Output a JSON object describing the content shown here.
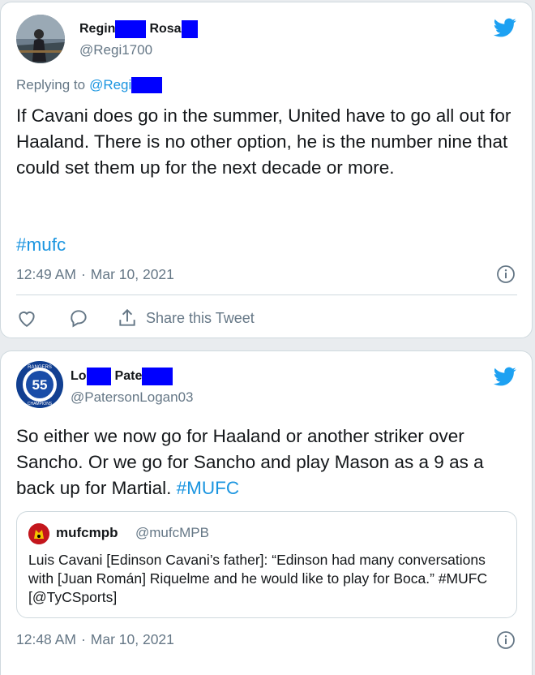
{
  "tweet1": {
    "display_name_part1": "Regin",
    "display_name_part2": "Rosa",
    "handle": "@Regi1700",
    "replying_label": "Replying to",
    "replying_handle": "@Regi",
    "text": "If Cavani does go in the summer, United have to go all out for Haaland. There is no other option, he is the number nine that could set them up for the next decade or more.",
    "hashtag": "#mufc",
    "time": "12:49 AM",
    "separator": "·",
    "date": "Mar 10, 2021",
    "share_label": "Share this Tweet"
  },
  "tweet2": {
    "display_name_part1": "Lo",
    "display_name_part2": "Pate",
    "handle": "@PatersonLogan03",
    "avatar_badge_text": "55",
    "avatar_ring_top": "RANGERS",
    "avatar_ring_bottom": "CHAMPIONS",
    "text": "So either we now go for Haaland or another striker over Sancho. Or we go for Sancho and play Mason as a 9 as a back up for Martial.",
    "hashtag": "#MUFC",
    "quoted": {
      "name": "mufcmpb",
      "handle": "@mufcMPB",
      "text": "Luis Cavani [Edinson Cavani’s father]: “Edinson had many conversations with [Juan Román] Riquelme and he would like to play for Boca.” #MUFC [@TyCSports]"
    },
    "time": "12:48 AM",
    "separator": "·",
    "date": "Mar 10, 2021"
  },
  "colors": {
    "twitter_blue": "#1da1f2",
    "hashtag_blue": "#1b95e0",
    "secondary_text": "#657786",
    "border": "#cfd9de",
    "redaction": "#0000ff"
  }
}
